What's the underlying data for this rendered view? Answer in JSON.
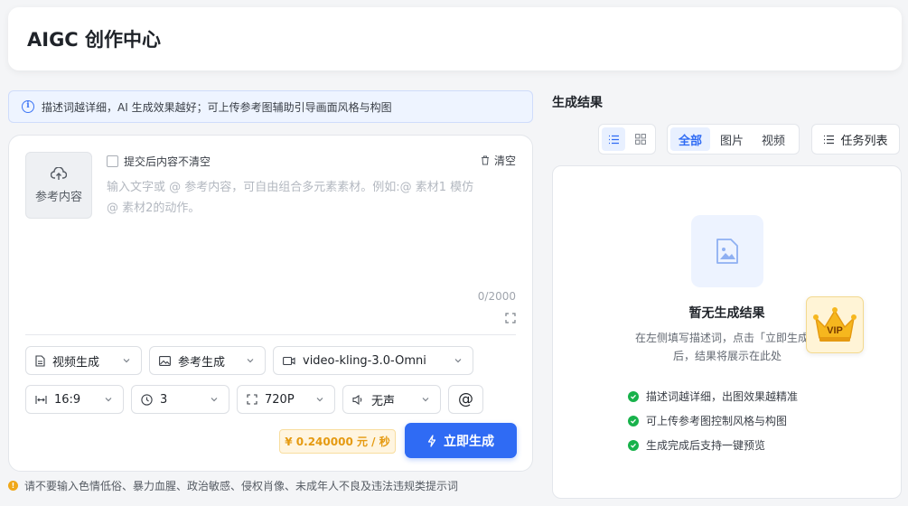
{
  "header": {
    "title": "AIGC 创作中心"
  },
  "tip": {
    "text": "描述词越详细，AI 生成效果越好；可上传参考图辅助引导画面风格与构图"
  },
  "editor": {
    "ref_label": "参考内容",
    "keep_content_label": "提交后内容不清空",
    "keep_content_checked": false,
    "clear_label": "清空",
    "placeholder": "输入文字或 @ 参考内容，可自由组合多元素素材。例如:@ 素材1 模仿 @ 素材2的动作。",
    "counter": "0/2000"
  },
  "options": {
    "mode": "视频生成",
    "ref_mode": "参考生成",
    "model": "video-kling-3.0-Omni",
    "ratio": "16:9",
    "duration": "3",
    "resolution": "720P",
    "audio": "无声",
    "mention_symbol": "@"
  },
  "price": "¥ 0.240000 元 / 秒",
  "generate_label": "立即生成",
  "warning": "请不要输入色情低俗、暴力血腥、政治敏感、侵权肖像、未成年人不良及违法违规类提示词",
  "results": {
    "title": "生成结果",
    "filters": [
      "全部",
      "图片",
      "视频"
    ],
    "active_filter": "全部",
    "task_list_label": "任务列表",
    "empty_title": "暂无生成结果",
    "empty_desc": "在左侧填写描述词，点击「立即生成」后，结果将展示在此处",
    "features": [
      "描述词越详细，出图效果越精准",
      "可上传参考图控制风格与构图",
      "生成完成后支持一键预览"
    ],
    "vip_label": "VIP"
  },
  "colors": {
    "accent": "#2f6bf4",
    "price": "#e59a11",
    "success": "#18b24b",
    "warning": "#f0a81a"
  }
}
